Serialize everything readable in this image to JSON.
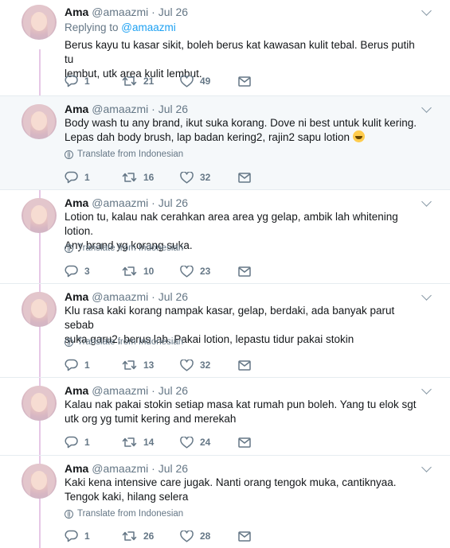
{
  "tweets": [
    {
      "name": "Ama",
      "handle": "@amaazmi · Jul 26",
      "reply_prefix": "Replying to ",
      "reply_mention": "@amaazmi",
      "lines": [
        "Berus kayu tu kasar sikit, boleh berus kat kawasan kulit tebal. Berus putih tu",
        "lembut, utk area kulit lembut."
      ],
      "translate": "",
      "replies": "1",
      "retweets": "21",
      "likes": "49"
    },
    {
      "name": "Ama",
      "handle": "@amaazmi · Jul 26",
      "lines": [
        "Body wash tu any brand, ikut suka korang. Dove ni best untuk kulit kering.",
        "Lepas dah body brush, lap badan kering2, rajin2 sapu lotion "
      ],
      "emoji": "grinning-face-emoji",
      "translate": "Translate from Indonesian",
      "replies": "1",
      "retweets": "16",
      "likes": "32"
    },
    {
      "name": "Ama",
      "handle": "@amaazmi · Jul 26",
      "lines": [
        "Lotion tu, kalau nak cerahkan area area yg gelap, ambik lah whitening lotion.",
        "Any brand yg korang suka."
      ],
      "translate": "Translate from Indonesian",
      "replies": "3",
      "retweets": "10",
      "likes": "23"
    },
    {
      "name": "Ama",
      "handle": "@amaazmi · Jul 26",
      "lines": [
        "Klu rasa kaki korang nampak kasar, gelap, berdaki, ada banyak parut sebab",
        "suka garu2, berus lah. Pakai lotion, lepastu tidur pakai stokin"
      ],
      "translate": "Translate from Indonesian",
      "replies": "1",
      "retweets": "13",
      "likes": "32"
    },
    {
      "name": "Ama",
      "handle": "@amaazmi · Jul 26",
      "lines": [
        "Kalau nak pakai stokin setiap masa kat rumah pun boleh. Yang tu elok sgt",
        "utk org yg tumit kering and merekah"
      ],
      "translate": "",
      "replies": "1",
      "retweets": "14",
      "likes": "24"
    },
    {
      "name": "Ama",
      "handle": "@amaazmi · Jul 26",
      "lines": [
        "Kaki kena intensive care jugak. Nanti orang tengok muka, cantiknyaa.",
        "Tengok kaki, hilang selera"
      ],
      "translate": "Translate from Indonesian",
      "replies": "1",
      "retweets": "26",
      "likes": "28"
    }
  ],
  "colors": {
    "accent": "#1da1f2",
    "muted": "#657786",
    "thread_line": "#e6c7e6",
    "highlight_bg": "#f5f8fa"
  }
}
